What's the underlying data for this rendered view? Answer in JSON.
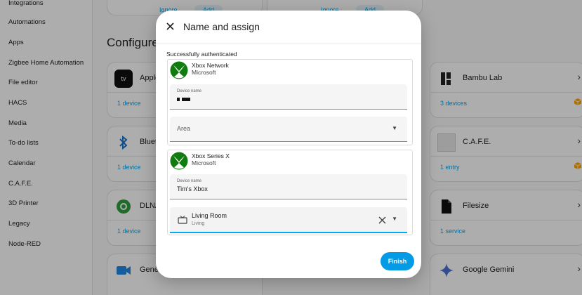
{
  "sidebar": {
    "items": [
      {
        "label": "Integrations"
      },
      {
        "label": "Automations"
      },
      {
        "label": "Apps"
      },
      {
        "label": "Zigbee Home Automation"
      },
      {
        "label": "File editor"
      },
      {
        "label": "HACS"
      },
      {
        "label": "Media"
      },
      {
        "label": "To-do lists"
      },
      {
        "label": "Calendar"
      },
      {
        "label": "C.A.F.E."
      },
      {
        "label": "3D Printer"
      },
      {
        "label": "Legacy"
      },
      {
        "label": "Node-RED"
      }
    ]
  },
  "discovered": {
    "ignore_label": "Ignore",
    "add_label": "Add"
  },
  "main": {
    "section_title": "Configured",
    "cards": [
      {
        "name": "Apple",
        "link": "1 device",
        "icon": "appletv-icon"
      },
      {
        "name": "Bambu Lab",
        "link": "3 devices",
        "icon": "bambulab-icon",
        "badge": "custom-integration-icon"
      },
      {
        "name": "Bluetooth",
        "link": "1 device",
        "icon": "bluetooth-icon"
      },
      {
        "name": "C.A.F.E.",
        "link": "1 entry",
        "icon": "cafe-icon",
        "badge": "custom-integration-icon"
      },
      {
        "name": "DLNA",
        "link": "1 device",
        "icon": "dlna-icon"
      },
      {
        "name": "Filesize",
        "link": "1 service",
        "icon": "file-icon"
      },
      {
        "name": "Gene",
        "link": "",
        "icon": "generic-camera-icon"
      },
      {
        "name": "Google Gemini",
        "link": "",
        "icon": "gemini-icon"
      }
    ]
  },
  "dialog": {
    "title": "Name and assign",
    "auth_text": "Successfully authenticated",
    "devices": [
      {
        "name": "Xbox Network",
        "manufacturer": "Microsoft",
        "device_name_label": "Device name",
        "device_name_value": "",
        "area_placeholder": "Area",
        "area_value": "",
        "area_sub": ""
      },
      {
        "name": "Xbox Series X",
        "manufacturer": "Microsoft",
        "device_name_label": "Device name",
        "device_name_value": "Tim's Xbox",
        "area_value": "Living Room",
        "area_sub": "Living"
      }
    ],
    "finish_label": "Finish"
  },
  "colors": {
    "accent": "#03a9f4",
    "finish": "#039be5",
    "xbox_green": "#107c10"
  }
}
